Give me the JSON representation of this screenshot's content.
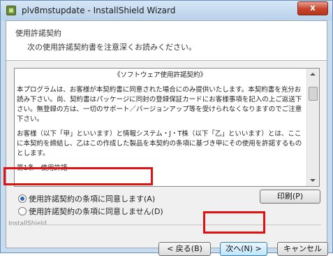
{
  "window": {
    "title": "plv8mstupdate - InstallShield Wizard",
    "close_label": "x"
  },
  "header": {
    "title": "使用許諾契約",
    "subtitle": "次の使用許諾契約書を注意深くお読みください。"
  },
  "license": {
    "heading": "《ソフトウェア使用許諾契約》",
    "paragraph1": "本プログラムは、お客様が本契約書に同意された場合にのみ提供いたします。本契約書を充分お読み下さい。尚、契約書はパッケージに同封の登録保証カードにお客様事項を記入の上ご返送下さい。無登録の方は、一切のサポート／バージョンアップ等を受けられなくなりますのでご注意下さい。",
    "paragraph2": "お客様（以下「甲」といいます）と情報システム・J・T株（以下「乙」といいます）とは、ここに本契約を締結し、乙はこの作成した製品を本契約の条項に基づき甲にその使用を許諾するものとします。",
    "section": "第1条　使用許諾"
  },
  "options": {
    "accept": "使用許諾契約の条項に同意します(A)",
    "decline": "使用許諾契約の条項に同意しません(D)",
    "selected": "accept"
  },
  "buttons": {
    "print": "印刷(P)",
    "back": "< 戻る(B)",
    "next": "次へ(N) >",
    "cancel": "キャンセル"
  },
  "footer": {
    "brand": "InstallShield"
  }
}
